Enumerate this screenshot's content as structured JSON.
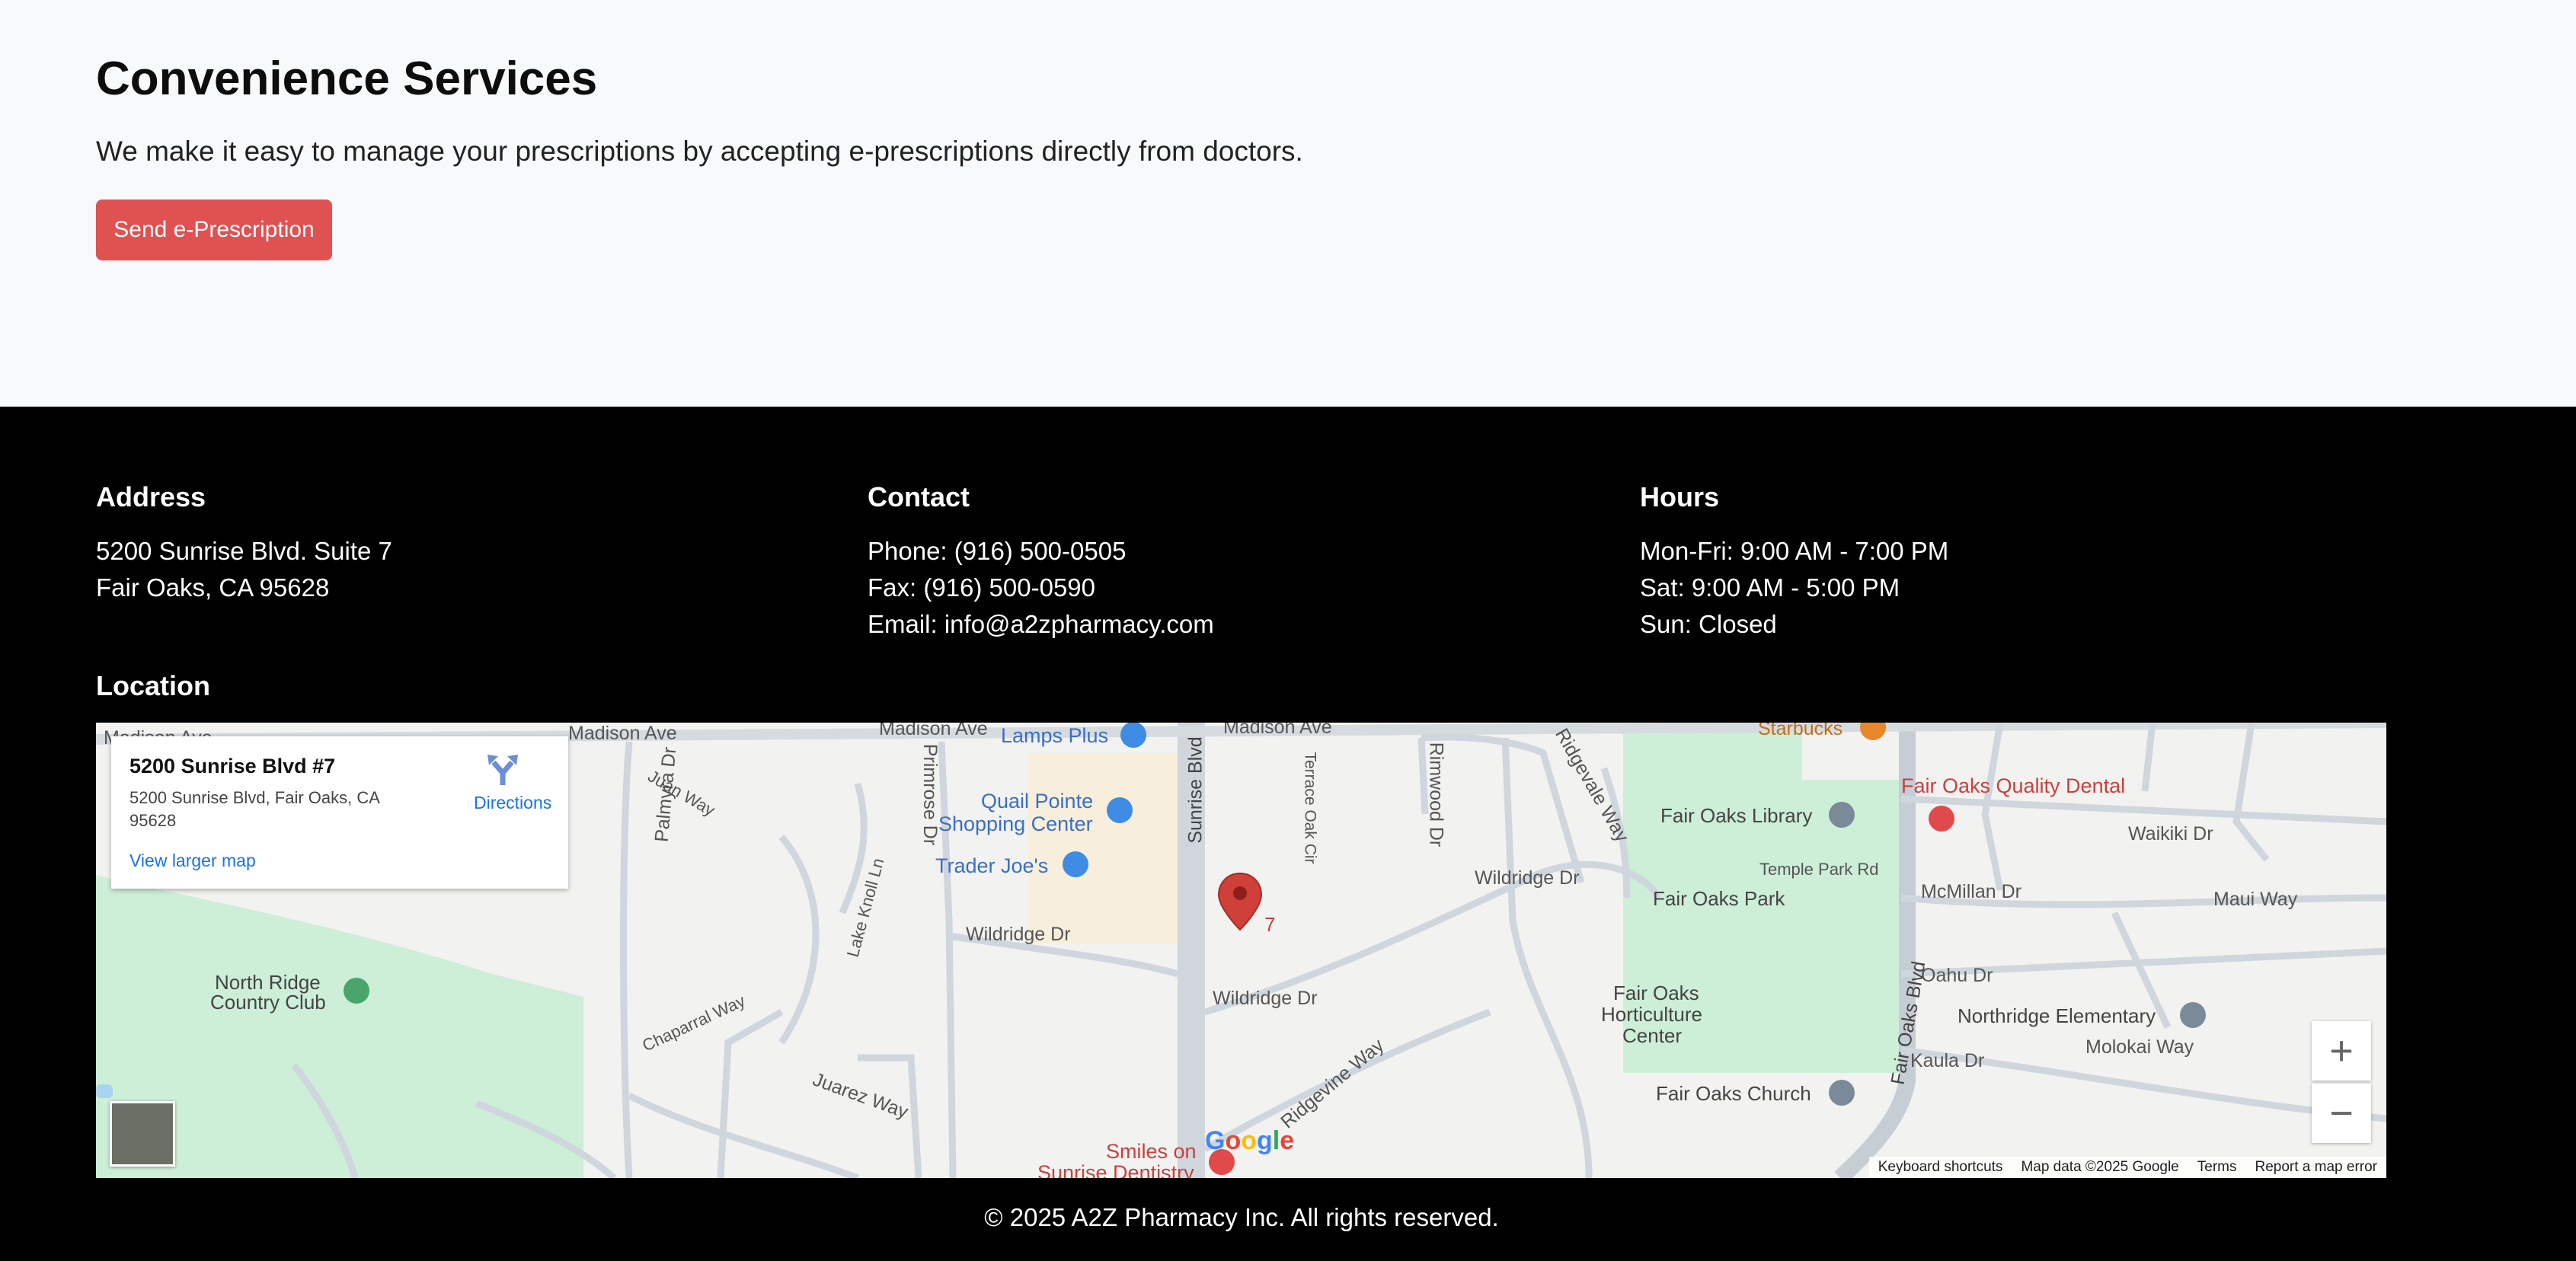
{
  "services": {
    "title": "Convenience Services",
    "description": "We make it easy to manage your prescriptions by accepting e-prescriptions directly from doctors.",
    "button_label": "Send e-Prescription"
  },
  "footer": {
    "address": {
      "heading": "Address",
      "lines": [
        "5200 Sunrise Blvd. Suite 7",
        "Fair Oaks, CA 95628"
      ]
    },
    "contact": {
      "heading": "Contact",
      "lines": [
        "Phone: (916) 500-0505",
        "Fax: (916) 500-0590",
        "Email: info@a2zpharmacy.com"
      ]
    },
    "hours": {
      "heading": "Hours",
      "lines": [
        "Mon-Fri: 9:00 AM - 7:00 PM",
        "Sat: 9:00 AM - 5:00 PM",
        "Sun: Closed"
      ]
    },
    "location_heading": "Location",
    "copyright": "© 2025 A2Z Pharmacy Inc. All rights reserved."
  },
  "map": {
    "card": {
      "place_name": "5200 Sunrise Blvd #7",
      "address": "5200 Sunrise Blvd, Fair Oaks, CA 95628",
      "directions_label": "Directions",
      "larger_map_label": "View larger map"
    },
    "marker_label": "7",
    "zoom_in": "+",
    "zoom_out": "−",
    "attribution": {
      "shortcuts": "Keyboard shortcuts",
      "data": "Map data ©2025 Google",
      "terms": "Terms",
      "report": "Report a map error"
    },
    "google_logo": "Google",
    "labels": {
      "madison_ave_1": "Madison Ave",
      "madison_ave_2": "Madison Ave",
      "madison_ave_3": "Madison Ave",
      "madison_ave_4": "Madison Ave",
      "lamps_plus": "Lamps Plus",
      "quail_pointe": "Quail Pointe",
      "shopping_center": "Shopping Center",
      "trader_joes": "Trader Joe's",
      "starbucks": "Starbucks",
      "fair_oaks_quality_dental": "Fair Oaks Quality Dental",
      "fair_oaks_library": "Fair Oaks Library",
      "temple_park_rd": "Temple Park Rd",
      "fair_oaks_park": "Fair Oaks Park",
      "waikiki_dr": "Waikiki Dr",
      "mcmillan_dr": "McMillan Dr",
      "maui_way": "Maui Way",
      "oahu_dr": "Oahu Dr",
      "northridge_elementary": "Northridge Elementary",
      "molokai_way": "Molokai Way",
      "kaula_dr": "Kaula Dr",
      "fair_oaks_church": "Fair Oaks Church",
      "fair_oaks": "Fair Oaks",
      "horticulture": "Horticulture",
      "center": "Center",
      "wildridge_dr_1": "Wildridge Dr",
      "wildridge_dr_2": "Wildridge Dr",
      "wildridge_dr_3": "Wildridge Dr",
      "ridgevale_way": "Ridgevale Way",
      "rimwood_dr": "Rimwood Dr",
      "terrace_oak_cir": "Terrace Oak Cir",
      "sunrise_blvd": "Sunrise Blvd",
      "primrose_dr": "Primrose Dr",
      "palmyra_dr": "Palmyra Dr",
      "juan_way": "Juan Way",
      "lake_knoll_ln": "Lake Knoll Ln",
      "north_ridge": "North Ridge",
      "country_club": "Country Club",
      "chaparral_way": "Chaparral Way",
      "juarez_way": "Juarez Way",
      "ridgevine_way": "Ridgevine Way",
      "fair_oaks_blvd": "Fair Oaks Blvd",
      "smiles_on": "Smiles on",
      "sunrise_dentistry": "Sunrise Dentistry"
    }
  }
}
